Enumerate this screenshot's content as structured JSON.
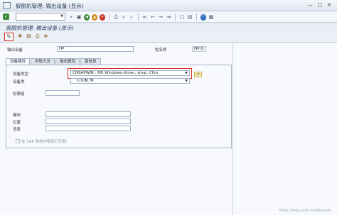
{
  "window": {
    "title": "假脱机管理: 输出设备 (显示)"
  },
  "toolbar": {
    "ok": "✓"
  },
  "transaction": {
    "title": "假脱机管理: 输出设备 (显示)"
  },
  "form": {
    "output_device_label": "输出设备",
    "output_device_value": "HP",
    "short_name_label": "短名称",
    "short_name_value": "HP 0"
  },
  "tabs": [
    {
      "label": "设备属性",
      "active": true
    },
    {
      "label": "存取方法",
      "active": false
    },
    {
      "label": "输出属性",
      "active": false
    },
    {
      "label": "盘信息",
      "active": false
    }
  ],
  "panel": {
    "device_type_label": "设备类型",
    "device_type_value": "CNSAPWIN : MS Windows driver, simp. Chin.",
    "device_class_label": "设备类",
    "device_class_value": "打印机 等",
    "auth_group_label": "权限组",
    "model_label": "模块",
    "location_label": "位置",
    "message_label": "消息",
    "lock_label": "在 SAP 系统中锁定打印机"
  },
  "watermark": "https://blog.csdn.net/kinginfo"
}
